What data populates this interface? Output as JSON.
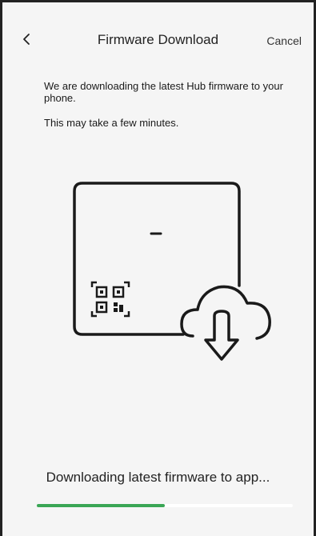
{
  "header": {
    "back_icon": "chevron-left-icon",
    "title": "Firmware Download",
    "cancel_label": "Cancel"
  },
  "description": {
    "line1": "We are downloading the latest Hub firmware to your phone.",
    "line2": "This may take a few minutes."
  },
  "illustration": {
    "device_icon": "hub-device-icon",
    "qr_icon": "qr-code-icon",
    "cloud_icon": "cloud-download-icon"
  },
  "progress": {
    "status_text": "Downloading latest firmware to app...",
    "fraction": 0.5,
    "fill_color": "#3aa655",
    "track_color": "#ffffff"
  }
}
